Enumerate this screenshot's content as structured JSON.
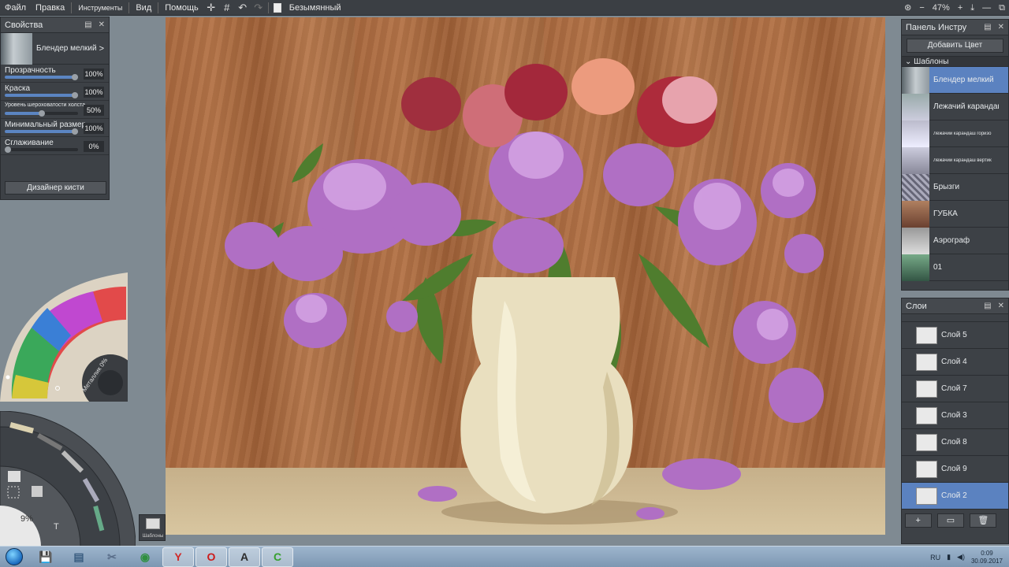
{
  "menubar": {
    "file": "Файл",
    "edit": "Правка",
    "tools": "Инструменты",
    "view": "Вид",
    "help": "Помощь",
    "document_title": "Безымянный",
    "zoom": "47%",
    "zoom_minus": "−",
    "zoom_plus": "+",
    "minimize": "—",
    "restore": "⧉"
  },
  "properties": {
    "title": "Свойства",
    "brush_name": "Блендер мелкий",
    "brush_arrow": ">",
    "sliders": [
      {
        "label": "Прозрачность",
        "value": "100%",
        "level": 1.0
      },
      {
        "label": "Краска",
        "value": "100%",
        "level": 1.0
      },
      {
        "label": "Уровень шероховатости холста",
        "value": "50%",
        "level": 0.5
      },
      {
        "label": "Минимальный размер",
        "value": "100%",
        "level": 1.0
      },
      {
        "label": "Сглаживание",
        "value": "0%",
        "level": 0.0
      }
    ],
    "designer_button": "Дизайнер кисти"
  },
  "color_wheel": {
    "metallic_label": "Металлик 0%",
    "current_color": "#9b7fa8"
  },
  "tool_fan": {
    "size_readout": "9%",
    "templates_label": "Шаблоны"
  },
  "tools_panel": {
    "title": "Панель Инстру",
    "add_color": "Добавить Цвет",
    "section": "Шаблоны",
    "items": [
      {
        "label": "Блендер мелкий",
        "active": true
      },
      {
        "label": "Лежачий карандаш2",
        "active": false
      },
      {
        "label": "Лежачий карандаш горизо",
        "active": false
      },
      {
        "label": "Лежачий карандаш вертик",
        "active": false
      },
      {
        "label": "Брызги",
        "active": false
      },
      {
        "label": "ГУБКА",
        "active": false
      },
      {
        "label": "Аэрограф",
        "active": false
      },
      {
        "label": "01",
        "active": false
      }
    ]
  },
  "layers_panel": {
    "title": "Слои",
    "layers": [
      {
        "label": "Слой 5",
        "active": false
      },
      {
        "label": "Слой 4",
        "active": false
      },
      {
        "label": "Слой 7",
        "active": false
      },
      {
        "label": "Слой 3",
        "active": false
      },
      {
        "label": "Слой 8",
        "active": false
      },
      {
        "label": "Слой 9",
        "active": false
      },
      {
        "label": "Слой 2",
        "active": true
      }
    ],
    "add": "+",
    "folder": "▭",
    "delete": "🗑"
  },
  "taskbar": {
    "apps": [
      "💾",
      "▤",
      "✂",
      "◉",
      "Y",
      "O",
      "A",
      "C"
    ],
    "lang": "RU",
    "time": "0:09",
    "date": "30.09.2017"
  },
  "colors": {
    "accent": "#5b82c0",
    "panel": "#3d4146"
  }
}
